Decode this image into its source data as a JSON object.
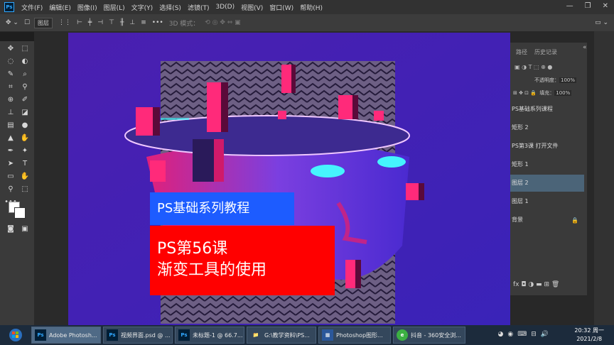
{
  "app": {
    "logo": "Ps"
  },
  "menu": [
    "文件(F)",
    "编辑(E)",
    "图像(I)",
    "图层(L)",
    "文字(Y)",
    "选择(S)",
    "滤镜(T)",
    "3D(D)",
    "视图(V)",
    "窗口(W)",
    "帮助(H)"
  ],
  "window_controls": {
    "minimize": "—",
    "maximize": "❐",
    "close": "✕"
  },
  "options_bar": {
    "layer_select": "图层",
    "mode_label": "3D 模式："
  },
  "tools_icons": [
    "move-icon",
    "marquee-icon",
    "lasso-icon",
    "quick-select-icon",
    "crop-icon",
    "eyedropper-icon",
    "healing-icon",
    "brush-icon",
    "stamp-icon",
    "history-brush-icon",
    "eraser-icon",
    "gradient-icon",
    "blur-icon",
    "dodge-icon",
    "pen-icon",
    "type-icon",
    "path-select-icon",
    "shape-icon",
    "hand-icon",
    "zoom-icon"
  ],
  "canvas": {
    "title_line": "PS基础系列教程",
    "lesson_line1": "PS第56课",
    "lesson_line2": "渐变工具的使用",
    "colors": {
      "blue_band": "#1d5cff",
      "red_band": "#ff0000",
      "background": "#4a1fb0"
    }
  },
  "layers_panel": {
    "tabs": [
      "路径",
      "历史记录"
    ],
    "opacity_label": "不透明度：",
    "opacity_value": "100%",
    "fill_label": "填充：",
    "fill_value": "100%",
    "layers": [
      {
        "name": "PS基础系列课程",
        "selected": false
      },
      {
        "name": "矩形 2",
        "selected": false
      },
      {
        "name": "PS第3课 打开文件",
        "selected": false
      },
      {
        "name": "矩形 1",
        "selected": false
      },
      {
        "name": "图层 2",
        "selected": true
      },
      {
        "name": "图层 1",
        "selected": false
      },
      {
        "name": "背景",
        "selected": false
      }
    ],
    "footer_icons": [
      "link-icon",
      "fx-icon",
      "mask-icon",
      "adjustment-icon",
      "group-icon",
      "new-layer-icon",
      "trash-icon"
    ],
    "fx_label": "fx"
  },
  "taskbar": {
    "items": [
      {
        "label": "Adobe Photosh...",
        "icon": "Ps",
        "active": true
      },
      {
        "label": "视频界面.psd @ ...",
        "icon": "Ps",
        "active": false
      },
      {
        "label": "未标题-1 @ 66.7...",
        "icon": "Ps",
        "active": false
      },
      {
        "label": "G:\\教学资料\\PS...",
        "icon": "📁",
        "active": false
      },
      {
        "label": "Photoshop图形...",
        "icon": "▦",
        "active": false
      },
      {
        "label": "抖音 - 360安全浏...",
        "icon": "e",
        "active": false
      }
    ],
    "time": "20:32 周一",
    "date": "2021/2/8"
  }
}
